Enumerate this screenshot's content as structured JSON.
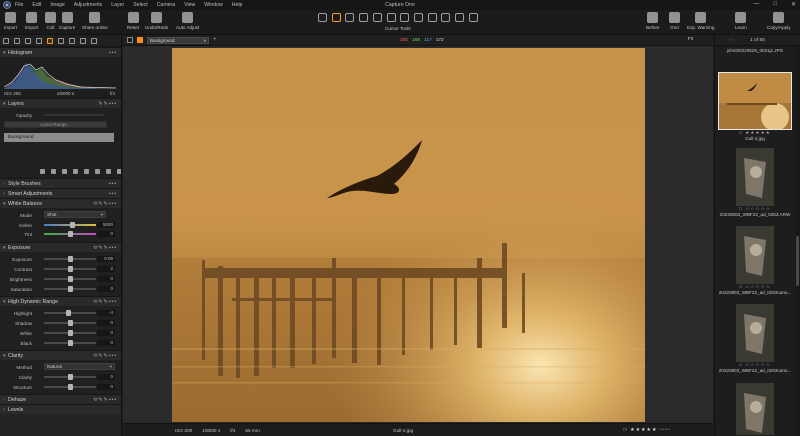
{
  "app": {
    "title": "Capture One"
  },
  "menu": [
    "File",
    "Edit",
    "Image",
    "Adjustments",
    "Layer",
    "Select",
    "Camera",
    "View",
    "Window",
    "Help"
  ],
  "window_controls": [
    "—",
    "□",
    "✕"
  ],
  "toolbar": {
    "import": "Import",
    "export": "Export",
    "cull": "Cull",
    "capture": "Capture",
    "share": "Share online",
    "reset": "Reset",
    "undo_redo": "Undo/Redo",
    "auto_adjust": "Auto Adjust",
    "cursor_tools": "Cursor Tools",
    "before": "Before",
    "grid": "Grid",
    "exp_warning": "Exp. Warning",
    "learn": "Learn",
    "copy_apply": "Copy/Apply"
  },
  "left_panel": {
    "histogram": {
      "title": "Histogram",
      "iso": "ISO 200",
      "shutter": "1/8000 s",
      "aperture": "f/4"
    },
    "layers": {
      "title": "Layers",
      "opacity_label": "Opacity",
      "luma_button": "Luma Range...",
      "layer_name": "Background"
    },
    "style_brushes": "Style Brushes",
    "smart_adjustments": "Smart Adjustments",
    "white_balance": {
      "title": "White Balance",
      "mode_label": "Mode",
      "mode_value": "Shot",
      "kelvin_label": "Kelvin",
      "kelvin_value": "5000",
      "tint_label": "Tint",
      "tint_value": "0",
      "kelvin_level": 0.55,
      "tint_level": 0.5
    },
    "exposure": {
      "title": "Exposure",
      "rows": [
        {
          "label": "Exposure",
          "value": "0.09",
          "level": 0.5
        },
        {
          "label": "Contrast",
          "value": "2",
          "level": 0.51
        },
        {
          "label": "Brightness",
          "value": "0",
          "level": 0.5
        },
        {
          "label": "Saturation",
          "value": "0",
          "level": 0.5
        }
      ]
    },
    "hdr": {
      "title": "High Dynamic Range",
      "rows": [
        {
          "label": "Highlight",
          "value": "-4",
          "level": 0.48
        },
        {
          "label": "Shadow",
          "value": "0",
          "level": 0.5
        },
        {
          "label": "White",
          "value": "0",
          "level": 0.5
        },
        {
          "label": "Black",
          "value": "0",
          "level": 0.5
        }
      ]
    },
    "clarity": {
      "title": "Clarity",
      "method_label": "Method",
      "method_value": "Natural",
      "rows": [
        {
          "label": "Clarity",
          "value": "0",
          "level": 0.5
        },
        {
          "label": "Structure",
          "value": "0",
          "level": 0.5
        }
      ]
    },
    "dehaze": "Dehaze",
    "cut_label": "Levels"
  },
  "viewer": {
    "variant": "Background",
    "fit": "Fit",
    "footer": {
      "iso": "ISO 200",
      "shutter": "1/8000 s",
      "aperture": "f/4",
      "focal": "66 mm",
      "filename": "Gull-2.jpg",
      "stars": "□ ★★★★★ ▫▫▫▫"
    }
  },
  "browser": {
    "counter": "1 of 55",
    "arrows": "‹ ›",
    "thumbs": [
      {
        "name": "johnl20220529_0021jc.JPG",
        "stars": ""
      },
      {
        "name": "Gull-2.jpg",
        "stars": "□ ★★★★★"
      },
      {
        "name": "20220803_WBF22_ad_0253.ARW",
        "stars": "□ ☆☆☆☆☆"
      },
      {
        "name": "20220803_WBF22_ad_0253cano...",
        "stars": "□ ☆☆☆☆☆"
      },
      {
        "name": "20220803_WBF22_ad_0253cano...",
        "stars": "□ ☆☆☆☆☆"
      }
    ]
  },
  "colors": {
    "accent": "#ff9a2b",
    "readout_red": "#ff5a5a",
    "readout_green": "#7ad36a",
    "readout_blue": "#5aa8ff"
  },
  "readouts": {
    "r": "200",
    "g": "168",
    "b": "117",
    "l": "172"
  }
}
